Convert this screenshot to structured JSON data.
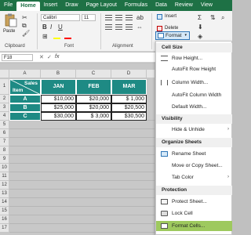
{
  "ribbon_tabs": [
    "File",
    "Home",
    "Insert",
    "Draw",
    "Page Layout",
    "Formulas",
    "Data",
    "Review",
    "View"
  ],
  "ribbon": {
    "paste_label": "Paste",
    "font_name": "Calibri",
    "font_size": "11",
    "bold": "B",
    "italic": "I",
    "underline": "U",
    "insert_label": "Insert",
    "delete_label": "Delete",
    "format_label": "Format",
    "groups": {
      "clipboard": "Clipboard",
      "font": "Font",
      "alignment": "Alignment",
      "cells": "C"
    }
  },
  "formula_bar": {
    "namebox": "F18",
    "fx": "fx"
  },
  "sheet": {
    "columns": [
      "A",
      "B",
      "C",
      "D"
    ],
    "rows": [
      "1",
      "2",
      "3",
      "4",
      "5",
      "6",
      "7",
      "8",
      "9",
      "10",
      "11",
      "12",
      "13",
      "14",
      "15",
      "16",
      "17"
    ],
    "table": {
      "corner_top": "Sales",
      "corner_bottom": "Item",
      "headers": [
        "JAN",
        "FEB",
        "MAR"
      ],
      "body": [
        {
          "item": "A",
          "values": [
            "$10,000",
            "$20,000",
            "$ 1,000"
          ]
        },
        {
          "item": "B",
          "values": [
            "$25,000",
            "$20,000",
            "$20,500"
          ]
        },
        {
          "item": "C",
          "values": [
            "$30,000",
            "$ 3,000",
            "$30,500"
          ]
        }
      ]
    }
  },
  "menu": {
    "sections": [
      {
        "title": "Cell Size",
        "items": [
          "Row Height...",
          "AutoFit Row Height",
          "Column Width...",
          "AutoFit Column Width",
          "Default Width..."
        ]
      },
      {
        "title": "Visibility",
        "items": [
          "Hide & Unhide"
        ]
      },
      {
        "title": "Organize Sheets",
        "items": [
          "Rename Sheet",
          "Move or Copy Sheet...",
          "Tab Color"
        ]
      },
      {
        "title": "Protection",
        "items": [
          "Protect Sheet...",
          "Lock Cell",
          "Format Cells..."
        ]
      }
    ]
  },
  "colors": {
    "excel_green": "#1e7145",
    "table_teal": "#1e8a84",
    "highlight": "#9ec95e"
  }
}
